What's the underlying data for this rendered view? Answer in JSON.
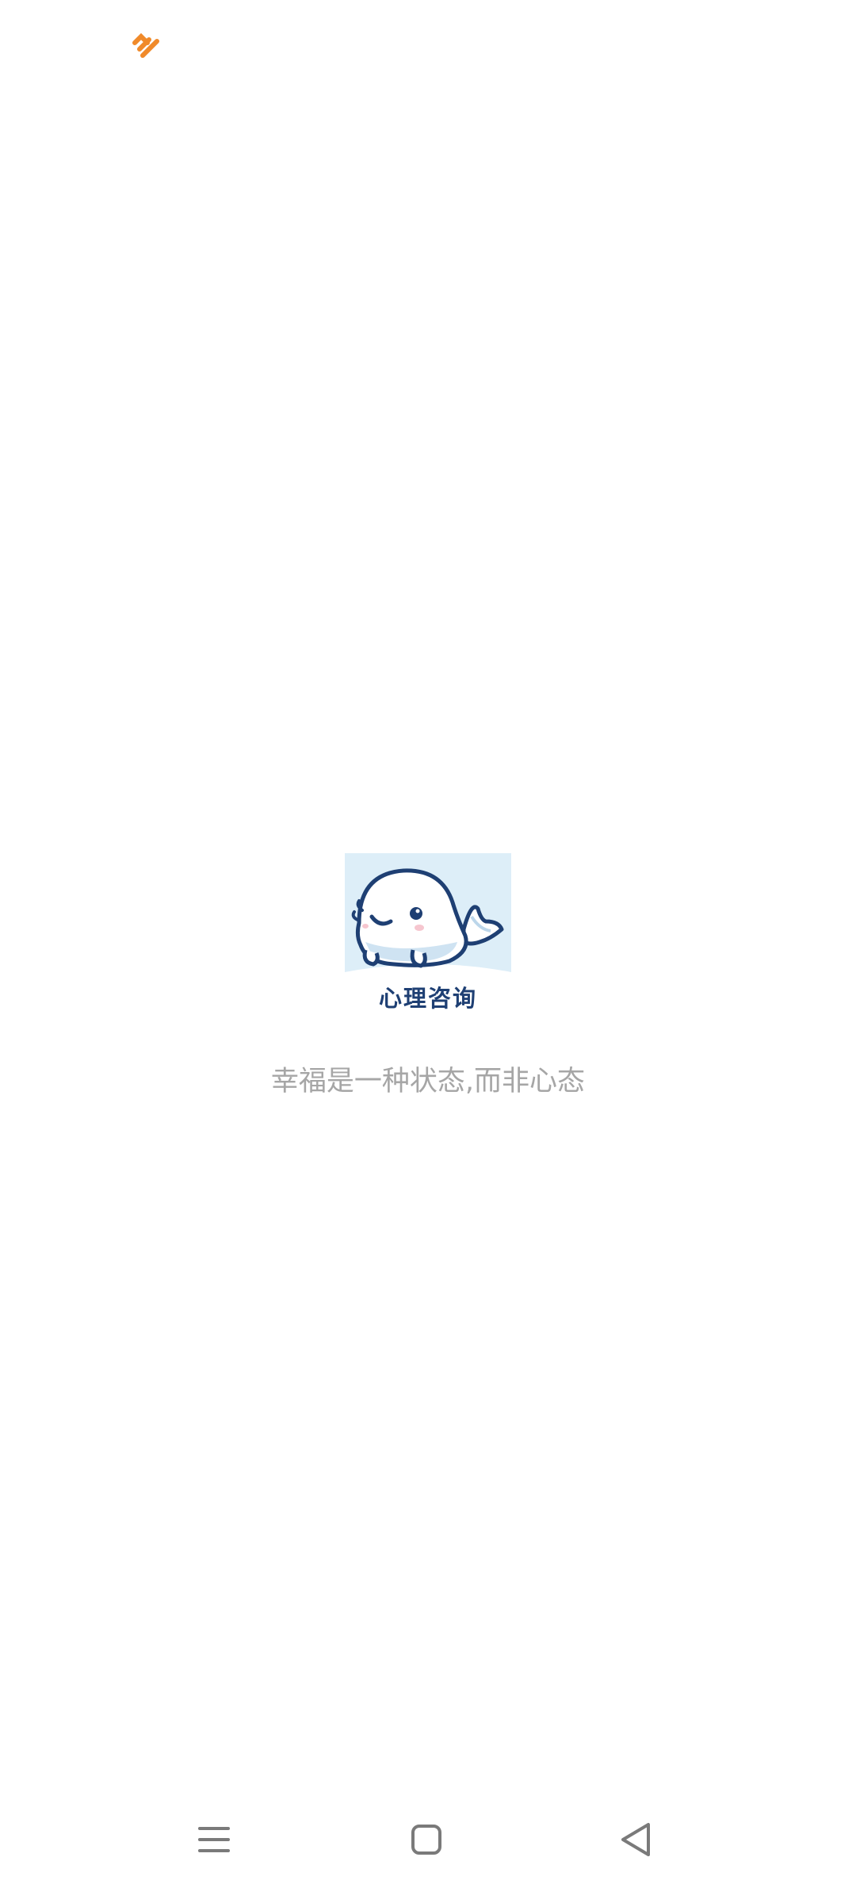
{
  "status_bar": {
    "notification_icon": "orange-app-notification-icon",
    "accent_color": "#f08a2a"
  },
  "splash": {
    "logo_icon": "whale-mascot-icon",
    "logo_caption": "心理咨询",
    "slogan": "幸福是一种状态,而非心态",
    "logo_bg_color": "#ddeef8",
    "logo_ink_color": "#1e3f73",
    "slogan_color": "#a6a6a6"
  },
  "nav_bar": {
    "menu_icon": "menu-lines-icon",
    "home_icon": "home-square-icon",
    "back_icon": "back-triangle-icon"
  }
}
